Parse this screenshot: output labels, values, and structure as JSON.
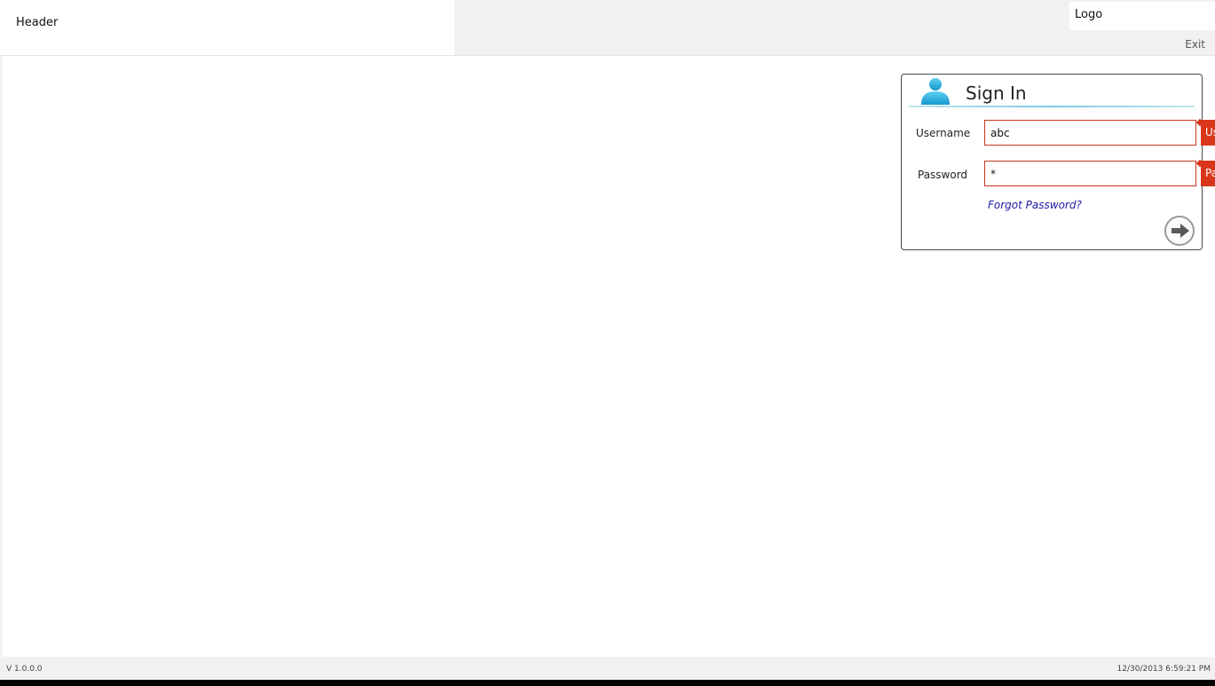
{
  "header": {
    "title": "Header",
    "logo": "Logo",
    "exit_label": "Exit"
  },
  "signin": {
    "title": "Sign In",
    "username_label": "Username",
    "username_value": "abc",
    "password_label": "Password",
    "password_value": "*",
    "username_error_tab": "Us",
    "password_error_tab": "Pa",
    "forgot_label": "Forgot Password?",
    "submit_icon": "arrow-right-icon",
    "user_icon": "user-icon"
  },
  "footer": {
    "version": "V 1.0.0.0",
    "datetime": "12/30/2013 6:59:21 PM"
  },
  "colors": {
    "error": "#d9361b",
    "accent": "#1fa8d8",
    "link": "#1a1aa6",
    "chrome": "#f1f1f1"
  }
}
